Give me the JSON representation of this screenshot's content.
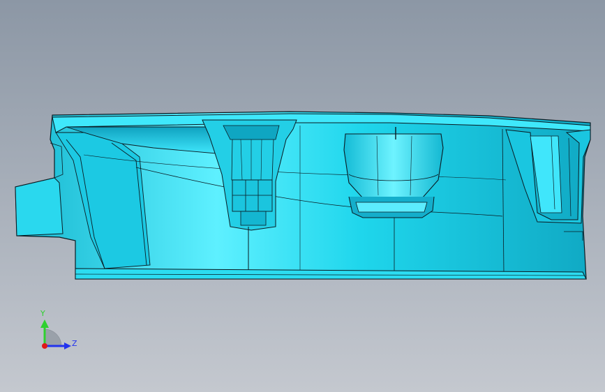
{
  "view": {
    "model_color": "#17d3e8",
    "edge_color": "#0a1a22",
    "background_top": "#8c97a5",
    "background_bottom": "#c4c8cf"
  },
  "triad": {
    "y_label": "Y",
    "z_label": "Z",
    "y_color": "#2fd12f",
    "z_color": "#2233ee",
    "x_color": "#e01818"
  }
}
